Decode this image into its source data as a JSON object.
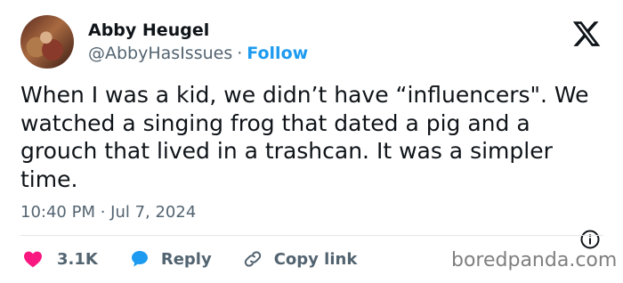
{
  "author": {
    "name": "Abby Heugel",
    "handle": "@AbbyHasIssues",
    "separator": "·",
    "follow_label": "Follow"
  },
  "tweet": {
    "text": "When I was a kid, we didn’t have “influencers\". We watched a singing frog that dated a pig and a grouch that lived in a trashcan. It was a simpler time.",
    "timestamp": "10:40 PM · Jul 7, 2024"
  },
  "actions": {
    "likes": "3.1K",
    "reply_label": "Reply",
    "copy_link_label": "Copy link"
  },
  "watermark": "boredpanda.com",
  "icons": {
    "logo": "x-logo-icon",
    "info": "info-icon",
    "like": "heart-icon",
    "reply": "reply-bubble-icon",
    "copy": "link-icon"
  },
  "colors": {
    "accent": "#1d9bf0",
    "like": "#f91880",
    "text": "#0f1419",
    "secondary": "#536471"
  }
}
